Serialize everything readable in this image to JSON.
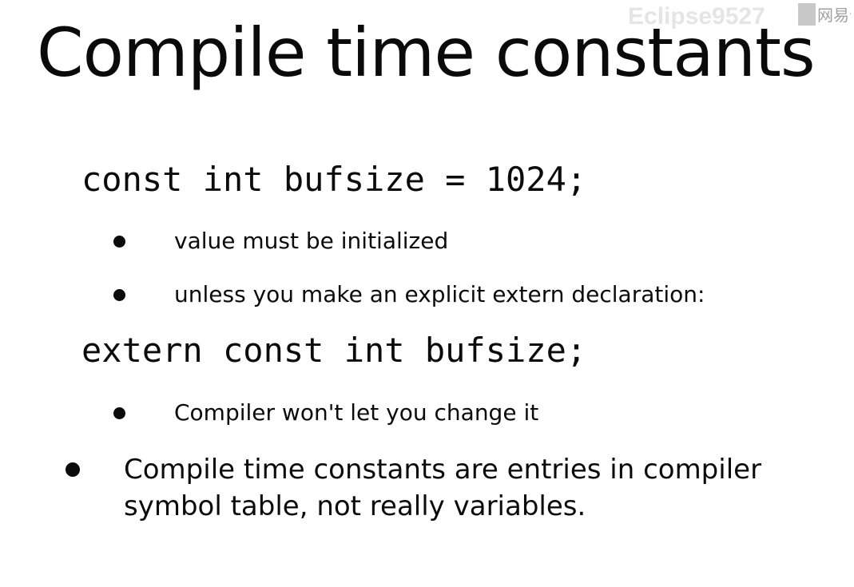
{
  "slide": {
    "title": "Compile time constants",
    "code_line_1": "const int bufsize = 1024;",
    "sub_bullets_1": [
      "value must be initialized",
      "unless you make an explicit extern declaration:"
    ],
    "code_line_2": "extern const int bufsize;",
    "sub_bullets_2": [
      "Compiler won't let you change it"
    ],
    "main_bullet": {
      "line_1": "Compile time constants are entries in compiler",
      "line_2": "symbol table, not really variables."
    }
  },
  "watermark": {
    "text": "Eclipse9527",
    "logo_text": "网易云"
  }
}
